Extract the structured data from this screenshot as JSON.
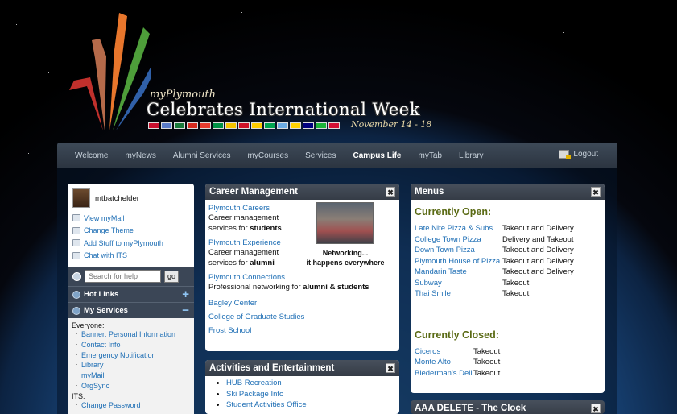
{
  "header": {
    "brand_small": "myPlymouth",
    "brand_big": "Celebrates International Week",
    "dates": "November 14 - 18",
    "flags": [
      "#c8102e",
      "#5b7cc9",
      "#1a7a3a",
      "#d52b1e",
      "#e63b2e",
      "#009246",
      "#f5c400",
      "#ce1126",
      "#ffcc00",
      "#00a550",
      "#6cace4",
      "#ffd100",
      "#000080",
      "#1eb53a",
      "#d21034"
    ]
  },
  "nav": {
    "items": [
      "Welcome",
      "myNews",
      "Alumni Services",
      "myCourses",
      "Services",
      "Campus Life",
      "myTab",
      "Library"
    ],
    "active": "Campus Life",
    "logout": "Logout"
  },
  "sidebar": {
    "username": "mtbatchelder",
    "links": [
      "View myMail",
      "Change Theme",
      "Add Stuff to myPlymouth",
      "Chat with ITS"
    ],
    "search_placeholder": "Search for help",
    "go_label": "go",
    "hot_links": "Hot Links",
    "my_services": "My Services",
    "groups": [
      {
        "label": "Everyone:",
        "items": [
          "Banner: Personal Information",
          "Contact Info",
          "Emergency Notification",
          "Library",
          "myMail",
          "OrgSync"
        ]
      },
      {
        "label": "ITS:",
        "items": [
          "Change Password"
        ]
      }
    ]
  },
  "career": {
    "title": "Career Management",
    "photo_caption_1": "Networking...",
    "photo_caption_2": "it happens everywhere",
    "careers_link": "Plymouth Careers",
    "careers_desc_1": "Career management",
    "careers_desc_2": "services for ",
    "careers_bold": "students",
    "experience_link": "Plymouth Experience",
    "experience_desc_1": "Career management",
    "experience_desc_2": "services for ",
    "experience_bold": "alumni",
    "connections_link": "Plymouth Connections",
    "connections_desc": "Professional networking for ",
    "connections_bold": "alumni & students",
    "bagley": "Bagley Center",
    "graduate": "College of Graduate Studies",
    "frost": "Frost School"
  },
  "activities": {
    "title": "Activities and Entertainment",
    "items": [
      "HUB Recreation",
      "Ski Package Info",
      "Student Activities Office"
    ]
  },
  "menus": {
    "title": "Menus",
    "open_heading": "Currently Open:",
    "open": [
      {
        "name": "Late Nite Pizza & Subs",
        "status": "Takeout and Delivery"
      },
      {
        "name": "College Town Pizza",
        "status": "Delivery and Takeout"
      },
      {
        "name": "Down Town Pizza",
        "status": "Takeout and Delivery"
      },
      {
        "name": "Plymouth House of Pizza",
        "status": "Takeout and Delivery"
      },
      {
        "name": "Mandarin Taste",
        "status": "Takeout and Delivery"
      },
      {
        "name": "Subway",
        "status": "Takeout"
      },
      {
        "name": "Thai Smile",
        "status": "Takeout"
      }
    ],
    "closed_heading": "Currently Closed:",
    "closed": [
      {
        "name": "Ciceros",
        "status": "Takeout"
      },
      {
        "name": "Monte Alto",
        "status": "Takeout"
      },
      {
        "name": "Biederman's Deli",
        "status": "Takeout"
      }
    ]
  },
  "clock": {
    "title": "AAA DELETE - The Clock"
  },
  "close_label": "✖"
}
